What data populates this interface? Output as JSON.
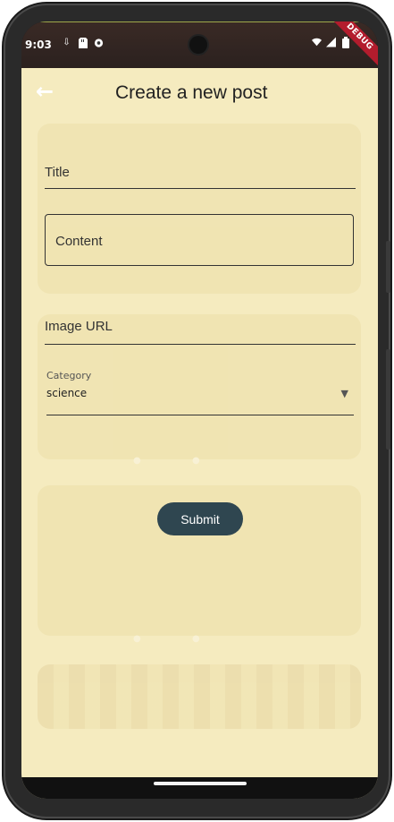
{
  "status_bar": {
    "time": "9:03",
    "left_icons": [
      "download-icon",
      "sd-card-icon",
      "media-icon"
    ],
    "right_icons": [
      "wifi-icon",
      "signal-icon",
      "battery-icon"
    ],
    "debug_label": "DEBUG"
  },
  "app_bar": {
    "back_icon": "arrow-left-icon",
    "title": "Create a new post"
  },
  "form": {
    "title_label": "Title",
    "content_label": "Content",
    "image_url_label": "Image URL",
    "category_label": "Category",
    "category_value": "science",
    "submit_label": "Submit"
  },
  "background_ghost": {
    "card1_text": "",
    "card2_text": "",
    "card3_text": ""
  },
  "colors": {
    "app_background": "#f5ebbf",
    "submit_button": "#2f4650",
    "debug_ribbon": "#b31c2d"
  }
}
